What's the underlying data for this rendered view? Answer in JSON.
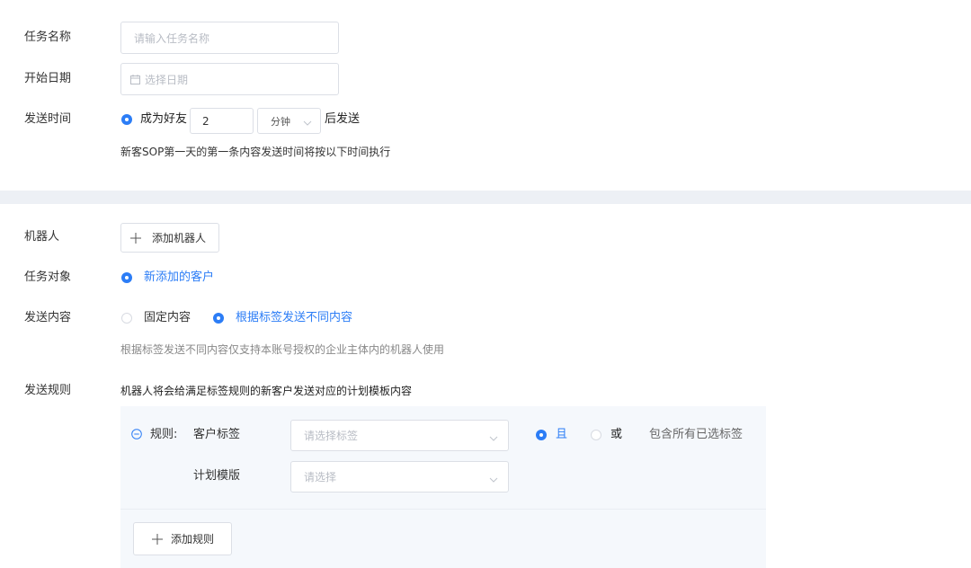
{
  "task": {
    "name_label": "任务名称",
    "name_placeholder": "请输入任务名称",
    "start_label": "开始日期",
    "start_placeholder": "选择日期",
    "send_time_label": "发送时间",
    "send_time_option": "成为好友",
    "send_time_value": "2",
    "send_time_unit": "分钟",
    "send_time_suffix": "后发送",
    "send_time_hint": "新客SOP第一天的第一条内容发送时间将按以下时间执行"
  },
  "config": {
    "robot_label": "机器人",
    "add_robot_button": "添加机器人",
    "target_label": "任务对象",
    "target_option": "新添加的客户",
    "content_label": "发送内容",
    "content_options": [
      "固定内容",
      "根据标签发送不同内容"
    ],
    "content_selected_index": 1,
    "content_hint": "根据标签发送不同内容仅支持本账号授权的企业主体内的机器人使用",
    "rules_label": "发送规则",
    "rules_desc": "机器人将会给满足标签规则的新客户发送对应的计划模板内容"
  },
  "rule": {
    "prefix": "规则:",
    "tag_label": "客户标签",
    "tag_placeholder": "请选择标签",
    "logic_options": [
      "且",
      "或"
    ],
    "logic_selected_index": 0,
    "logic_hint": "包含所有已选标签",
    "template_label": "计划模版",
    "template_placeholder": "请选择",
    "add_rule_button": "添加规则"
  },
  "colors": {
    "accent": "#2c7df6",
    "divider_band": "#edf0f5",
    "rule_panel": "#f5f8fc"
  },
  "icons": [
    "calendar-icon",
    "chevron-down-icon",
    "plus-icon",
    "minus-circle-icon"
  ]
}
